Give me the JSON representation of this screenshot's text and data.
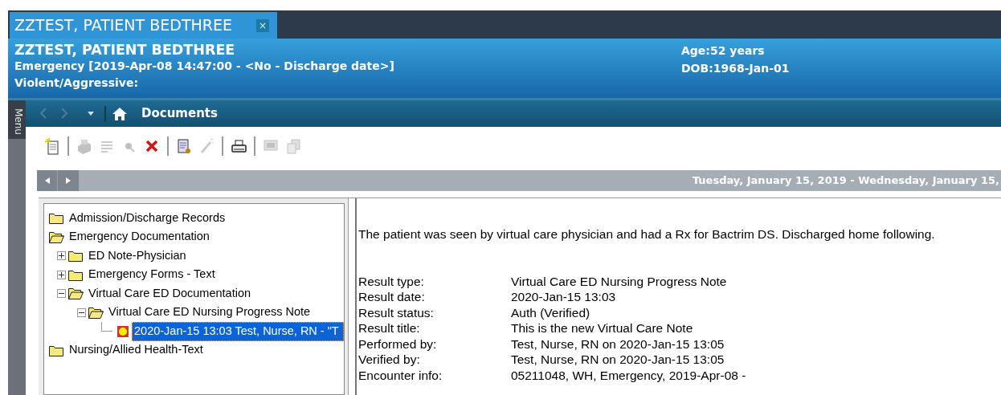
{
  "tab": {
    "label": "ZZTEST, PATIENT BEDTHREE",
    "close": "×",
    "selected": true
  },
  "header": {
    "name": "ZZTEST, PATIENT BEDTHREE",
    "encounter": "Emergency [2019-Apr-08 14:47:00 - <No - Discharge date>]",
    "alert": "Violent/Aggressive:",
    "age": "Age:52 years",
    "dob": "DOB:1968-Jan-01"
  },
  "sidebar": {
    "label": "Menu"
  },
  "nav": {
    "back": {
      "disabled": true
    },
    "forward": {
      "disabled": true
    },
    "title": "Documents"
  },
  "toolbar": [
    {
      "kind": "new",
      "disabled": false
    },
    {
      "kind": "separator"
    },
    {
      "kind": "scan",
      "disabled": true
    },
    {
      "kind": "list",
      "disabled": true
    },
    {
      "kind": "search",
      "disabled": true
    },
    {
      "kind": "delete",
      "disabled": false
    },
    {
      "kind": "separator"
    },
    {
      "kind": "preview",
      "disabled": false
    },
    {
      "kind": "wand",
      "disabled": true
    },
    {
      "kind": "separator"
    },
    {
      "kind": "print",
      "disabled": false
    },
    {
      "kind": "separator"
    },
    {
      "kind": "monitor",
      "disabled": true
    },
    {
      "kind": "pages",
      "disabled": true
    }
  ],
  "date_range": "Tuesday, January 15, 2019 - Wednesday, January 15,",
  "tree": [
    {
      "kind": "folder",
      "label": "Admission/Discharge Records",
      "expanded": false
    },
    {
      "kind": "folder",
      "label": "Emergency Documentation",
      "expanded": true,
      "children": [
        {
          "kind": "folder",
          "label": "ED Note-Physician",
          "expanded": false
        },
        {
          "kind": "folder",
          "label": "Emergency Forms - Text",
          "expanded": false
        },
        {
          "kind": "folder",
          "label": "Virtual Care ED Documentation",
          "expanded": true,
          "children": [
            {
              "kind": "folder",
              "label": "Virtual Care ED Nursing Progress Note",
              "expanded": true,
              "children": [
                {
                  "kind": "document",
                  "label": "2020-Jan-15 13:03  Test, Nurse, RN  - \"T",
                  "selected": true
                }
              ]
            }
          ]
        }
      ]
    },
    {
      "kind": "folder",
      "label": "Nursing/Allied Health-Text",
      "expanded": false
    }
  ],
  "document": {
    "body": "The patient was seen by virtual care physician and had a Rx for Bactrim DS.  Discharged home following.",
    "fields": [
      {
        "label": "Result type:",
        "value": "Virtual Care ED Nursing Progress Note"
      },
      {
        "label": "Result date:",
        "value": "2020-Jan-15 13:03"
      },
      {
        "label": "Result status:",
        "value": "Auth (Verified)"
      },
      {
        "label": "Result title:",
        "value": "This is the new Virtual Care Note"
      },
      {
        "label": "Performed by:",
        "value": "Test, Nurse, RN on 2020-Jan-15 13:05"
      },
      {
        "label": "Verified by:",
        "value": "Test, Nurse, RN on 2020-Jan-15 13:05"
      },
      {
        "label": "Encounter info:",
        "value": "05211048, WH, Emergency, 2019-Apr-08 -"
      }
    ]
  }
}
